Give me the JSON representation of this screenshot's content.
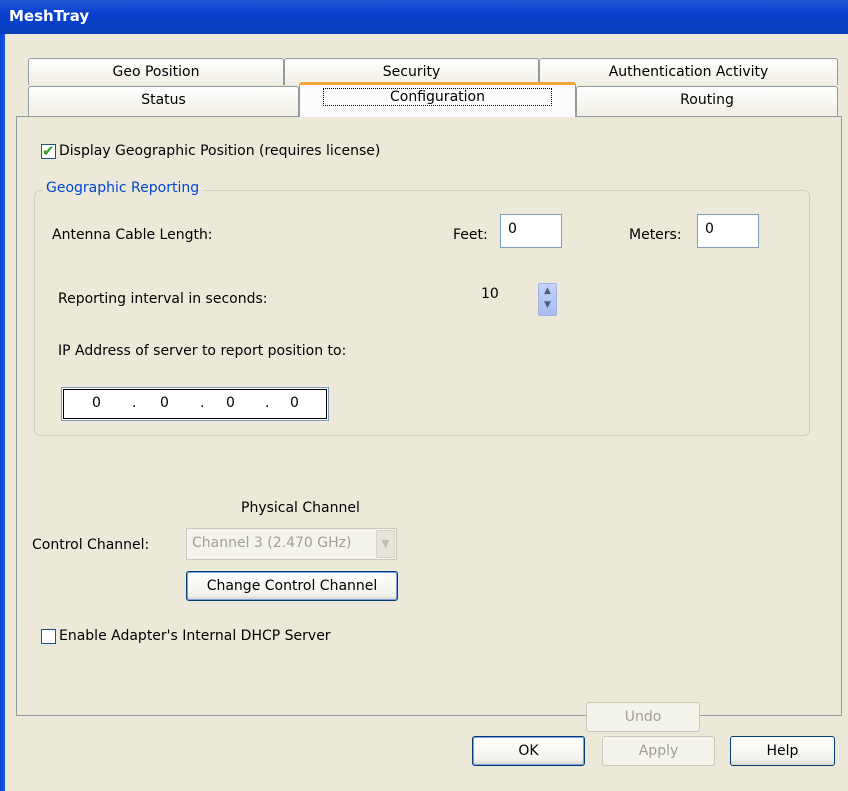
{
  "window": {
    "title": "MeshTray"
  },
  "tabs": {
    "row_top": [
      "Geo Position",
      "Security",
      "Authentication Activity"
    ],
    "row_bottom": [
      "Status",
      "Configuration",
      "Routing"
    ],
    "active": "Configuration"
  },
  "config": {
    "display_geo_label": "Display Geographic Position (requires license)",
    "display_geo_checked": true,
    "group_title": "Geographic Reporting",
    "antenna_label": "Antenna Cable Length:",
    "feet_label": "Feet:",
    "feet_value": "0",
    "meters_label": "Meters:",
    "meters_value": "0",
    "interval_label": "Reporting interval in seconds:",
    "interval_value": "10",
    "ip_label": "IP Address of server to report position to:",
    "ip_octets": [
      "0",
      "0",
      "0",
      "0"
    ],
    "ip_dots": [
      ".",
      ".",
      "."
    ],
    "physical_channel_label": "Physical Channel",
    "control_channel_label": "Control Channel:",
    "control_channel_value": "Channel 3 (2.470 GHz)",
    "change_channel_button": "Change Control Channel",
    "dhcp_label": "Enable Adapter's Internal DHCP Server",
    "dhcp_checked": false,
    "undo_button": "Undo"
  },
  "footer": {
    "ok": "OK",
    "apply": "Apply",
    "help": "Help"
  },
  "icons": {
    "check": "checkmark-icon",
    "spin_up": "spin-up-icon",
    "spin_down": "spin-down-icon",
    "dropdown": "chevron-down-icon"
  }
}
